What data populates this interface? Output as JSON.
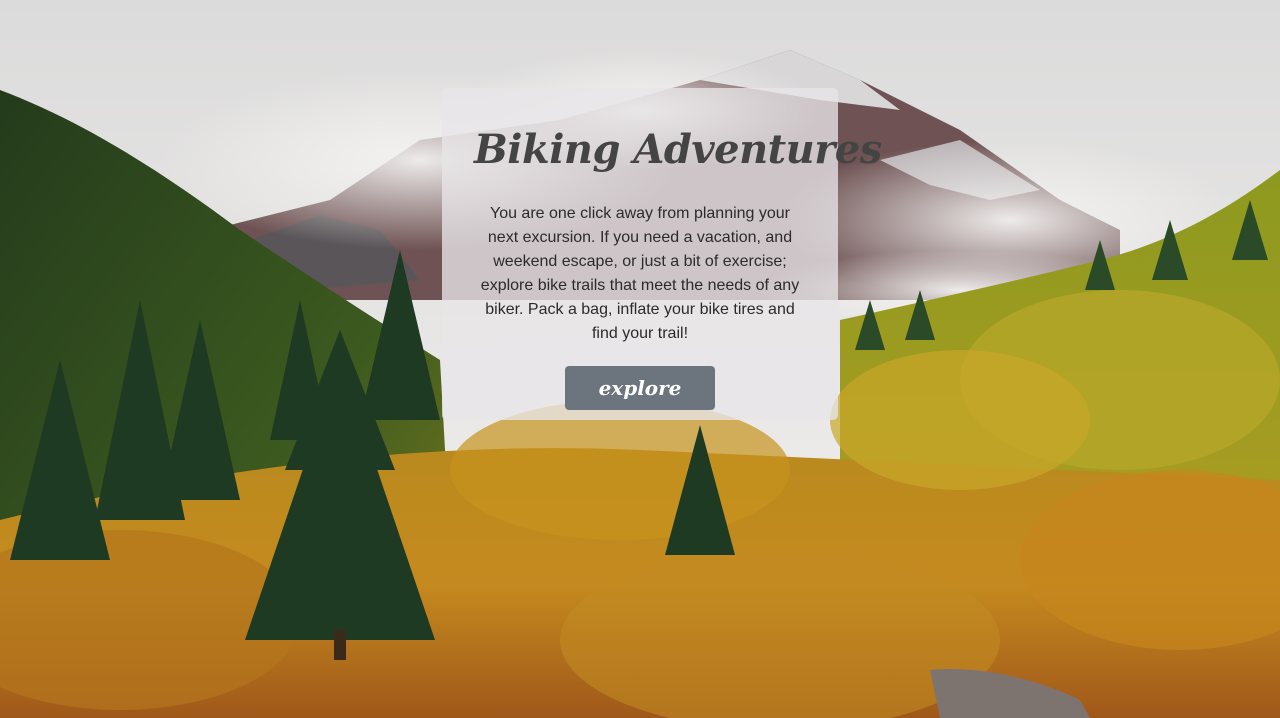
{
  "hero": {
    "title": "Biking Adventures",
    "description": "You are one click away from planning your next excursion. If you need a vacation, and weekend escape, or just a bit of exercise; explore bike trails that meet the needs of any biker. Pack a bag, inflate your bike tires and find your trail!",
    "button_label": "explore"
  },
  "colors": {
    "card_background": "#e8e6e8",
    "title_text": "#444444",
    "body_text": "#2b2b2b",
    "button_background": "#6c757d",
    "button_text": "#ffffff"
  }
}
